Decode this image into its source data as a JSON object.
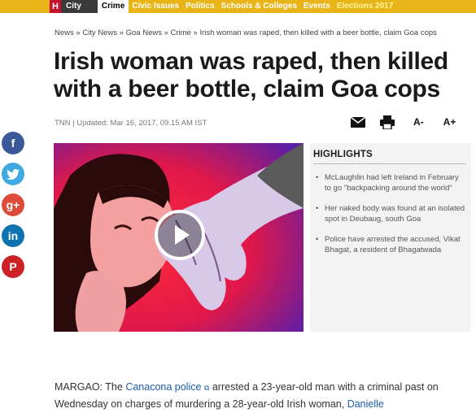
{
  "nav": {
    "home_letter": "H",
    "items": [
      "City",
      "Crime",
      "Civic Issues",
      "Politics",
      "Schools & Colleges",
      "Events",
      "Elections 2017"
    ]
  },
  "breadcrumb": "News » City News » Goa News » Crime » Irish woman was raped, then killed with a beer bottle, claim Goa cops",
  "headline": "Irish woman was raped, then killed with a beer bottle, claim Goa cops",
  "byline": "TNN | Updated: Mar 16, 2017, 09.15 AM IST",
  "tools": {
    "mail_icon": "mail-icon",
    "print_icon": "print-icon",
    "font_decrease": "A-",
    "font_increase": "A+"
  },
  "social": {
    "facebook": "f",
    "twitter": "t",
    "googleplus": "g+",
    "linkedin": "in",
    "pinterest": "P"
  },
  "highlights": {
    "title": "HIGHLIGHTS",
    "items": [
      "McLaughlin had left Ireland in February to go \"backpacking around the world\"",
      "Her naked body was found at an isolated spot in Deubaug, south Goa",
      "Police have arrested the accused, Vikat Bhagat, a resident of Bhagatwada"
    ]
  },
  "body": {
    "lead": "MARGAO: The",
    "link1": "Canacona police",
    "text1": " arrested a 23-year-old man with a criminal past on Wednesday on charges of murdering a 28-year-old Irish woman,",
    "link2": "Danielle"
  },
  "colors": {
    "nav_bg": "#e8b418",
    "link": "#1a5ca8"
  }
}
